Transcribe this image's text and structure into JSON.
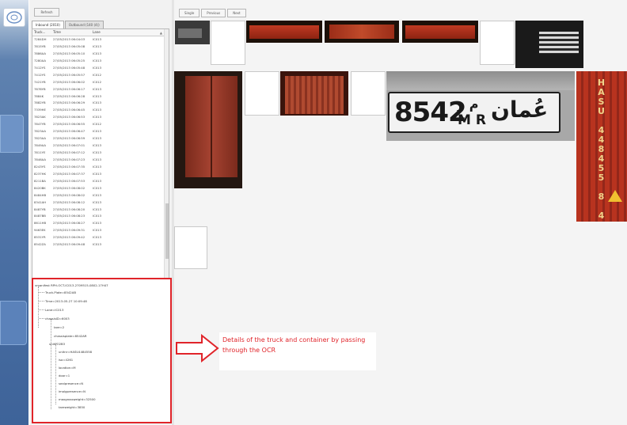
{
  "toolbar": {
    "refresh_label": "Refresh"
  },
  "tabs": [
    {
      "label": "Inbound (2010)"
    },
    {
      "label": "Outbound (140 (4))"
    }
  ],
  "grid": {
    "columns": [
      "Truck...",
      "Time",
      "Lane"
    ],
    "rows": [
      [
        "7284DH",
        "27/05/2013 06:04:03",
        "IC013"
      ],
      [
        "7815YB",
        "27/05/2013 06:05:08",
        "IC013"
      ],
      [
        "7886AA",
        "27/05/2013 06:05:10",
        "IC013"
      ],
      [
        "7280AA",
        "27/05/2013 06:05:25",
        "IC013"
      ],
      [
        "7412YS",
        "27/05/2013 06:05:48",
        "IC013"
      ],
      [
        "7412YS",
        "27/05/2013 06:05:57",
        "IC012"
      ],
      [
        "7421YB",
        "27/05/2013 06:06:02",
        "IC012"
      ],
      [
        "7878YB",
        "27/05/2013 06:06:17",
        "IC013"
      ],
      [
        "7884K",
        "27/05/2013 06:06:28",
        "IC013"
      ],
      [
        "7882YB",
        "27/05/2013 06:06:29",
        "IC013"
      ],
      [
        "7339HE",
        "27/05/2013 06:06:45",
        "IC013"
      ],
      [
        "7823AK",
        "27/05/2013 06:06:53",
        "IC013"
      ],
      [
        "7847YB",
        "27/05/2013 06:06:55",
        "IC012"
      ],
      [
        "7823AA",
        "27/05/2013 06:06:47",
        "IC013"
      ],
      [
        "7823AA",
        "27/05/2013 06:06:59",
        "IC013"
      ],
      [
        "7849AA",
        "27/05/2013 06:07:01",
        "IC013"
      ],
      [
        "7811YE",
        "27/05/2013 06:07:12",
        "IC013"
      ],
      [
        "7846AA",
        "27/05/2013 06:07:23",
        "IC013"
      ],
      [
        "8243YS",
        "27/05/2013 06:07:35",
        "IC013"
      ],
      [
        "8237HK",
        "27/05/2013 06:07:37",
        "IC013"
      ],
      [
        "8211BA",
        "27/05/2013 06:07:53",
        "IC013"
      ],
      [
        "8420BK",
        "27/05/2013 06:08:02",
        "IC013"
      ],
      [
        "8484HB",
        "27/05/2013 06:08:02",
        "IC013"
      ],
      [
        "8341AH",
        "27/05/2013 06:08:12",
        "IC013"
      ],
      [
        "8487YB",
        "27/05/2013 06:08:20",
        "IC013"
      ],
      [
        "8487BB",
        "27/05/2013 06:08:23",
        "IC013"
      ],
      [
        "8611HB",
        "27/05/2013 06:08:27",
        "IC013"
      ],
      [
        "9463EK",
        "27/05/2013 06:09:31",
        "IC013"
      ],
      [
        "8531YR",
        "27/05/2013 06:09:42",
        "IC013"
      ],
      [
        "8542ZA",
        "27/05/2013 06:09:48",
        "IC013"
      ]
    ]
  },
  "tree": {
    "root": "vmanifest RPH-OCT-IC013-2709515-0802-17H47",
    "truck_plate": "Truck-Plate=8542AB",
    "time": "Time=2013-05-27 10:09:48",
    "lane": "Lane=IC013",
    "chassis": "chassisID=6003",
    "tare": "tare=2",
    "chassis_plate": "chassisplate=8542AR",
    "unit": "unitPO2B3",
    "unitnr": "unitnr=HASU4484558",
    "iso": "iso=4261",
    "location": "location=M",
    "door": "door=1",
    "seal": "sealpresence=N",
    "imo": "imolgpresence=N",
    "maxgross": "maxgrossweight=32500",
    "tareweight": "tareweight=3850"
  },
  "nav": {
    "single": "Single",
    "previous": "Previous",
    "next": "Next"
  },
  "plate": {
    "digits": "8542",
    "latin": "M R",
    "arabic_small": "م ر",
    "arabic_word": "عُمان"
  },
  "container_vertical_text": "HASU 448455 8 45G1",
  "annotation": {
    "text": "Details of the truck and container by passing through the OCR"
  },
  "colors": {
    "annotation_red": "#e0242a",
    "rail_blue": "#4a6fa3",
    "container_red": "#a8291b"
  }
}
